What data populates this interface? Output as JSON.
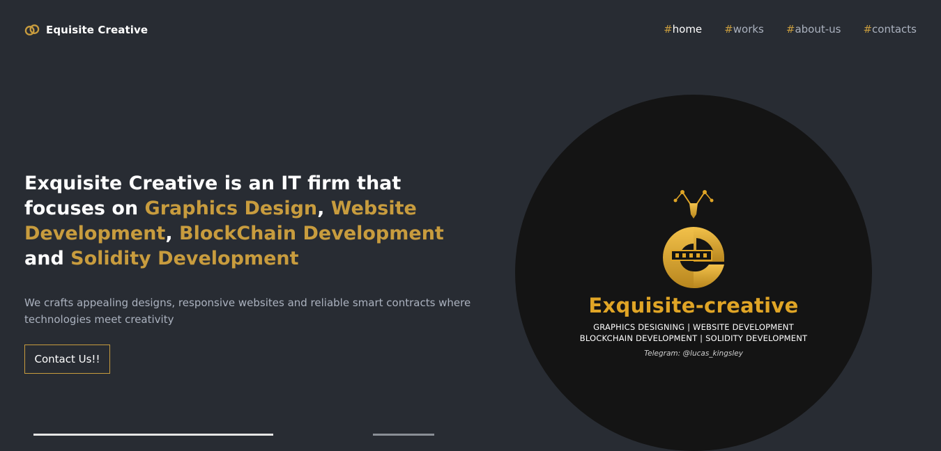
{
  "brand": {
    "name": "Equisite Creative",
    "icon": "interlocking-rings-logo",
    "accent_color": "#c89c3e"
  },
  "nav": {
    "items": [
      {
        "hash": "#",
        "label": "home",
        "active": true
      },
      {
        "hash": "#",
        "label": "works",
        "active": false
      },
      {
        "hash": "#",
        "label": "about-us",
        "active": false
      },
      {
        "hash": "#",
        "label": "contacts",
        "active": false
      }
    ]
  },
  "hero": {
    "title_parts": {
      "p1": "Exquisite Creative is an IT firm that focuses on ",
      "h1": "Graphics Design",
      "s1": ", ",
      "h2": "Website Development",
      "s2": ", ",
      "h3": "BlockChain Development",
      "s3": " and ",
      "h4": "Solidity Development"
    },
    "description": "We crafts appealing designs, responsive websites and reliable smart contracts where technologies meet creativity",
    "cta_label": "Contact Us!!"
  },
  "badge": {
    "name": "Exquisite-creative",
    "services_line1": "GRAPHICS DESIGNING   |   WEBSITE DEVELOPMENT",
    "services_line2": "BLOCKCHAIN DEVELOPMENT   |   SOLIDITY DEVELOPMENT",
    "contact": "Telegram: @lucas_kingsley",
    "emblem_icon": "ec-pen-nib-emblem",
    "colors": {
      "background": "#141414",
      "gold": "#e0a526"
    }
  }
}
